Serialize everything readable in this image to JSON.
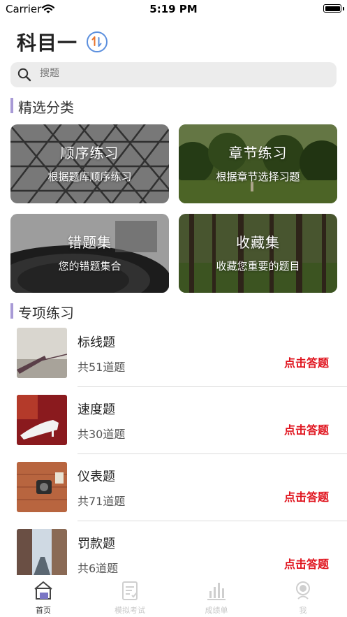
{
  "status_bar": {
    "carrier": "Carrier",
    "time": "5:19 PM"
  },
  "header": {
    "title": "科目一",
    "switch_icon": "switch-icon"
  },
  "search": {
    "placeholder": "搜题"
  },
  "featured": {
    "title": "精选分类",
    "cards": [
      {
        "title": "顺序练习",
        "subtitle": "根据题库顺序练习"
      },
      {
        "title": "章节练习",
        "subtitle": "根据章节选择习题"
      },
      {
        "title": "错题集",
        "subtitle": "您的错题集合"
      },
      {
        "title": "收藏集",
        "subtitle": "收藏您重要的题目"
      }
    ]
  },
  "special": {
    "title": "专项练习",
    "items": [
      {
        "title": "标线题",
        "count": "共51道题",
        "action": "点击答题"
      },
      {
        "title": "速度题",
        "count": "共30道题",
        "action": "点击答题"
      },
      {
        "title": "仪表题",
        "count": "共71道题",
        "action": "点击答题"
      },
      {
        "title": "罚款题",
        "count": "共6道题",
        "action": "点击答题"
      }
    ]
  },
  "tab_bar": {
    "tabs": [
      {
        "label": "首页",
        "icon": "home-icon",
        "active": true
      },
      {
        "label": "模拟考试",
        "icon": "exam-icon",
        "active": false
      },
      {
        "label": "成绩单",
        "icon": "chart-icon",
        "active": false
      },
      {
        "label": "我",
        "icon": "profile-icon",
        "active": false
      }
    ]
  },
  "colors": {
    "accent": "#5b8fde",
    "section_bar": "#a89ad6",
    "action_red": "#e0141e"
  }
}
